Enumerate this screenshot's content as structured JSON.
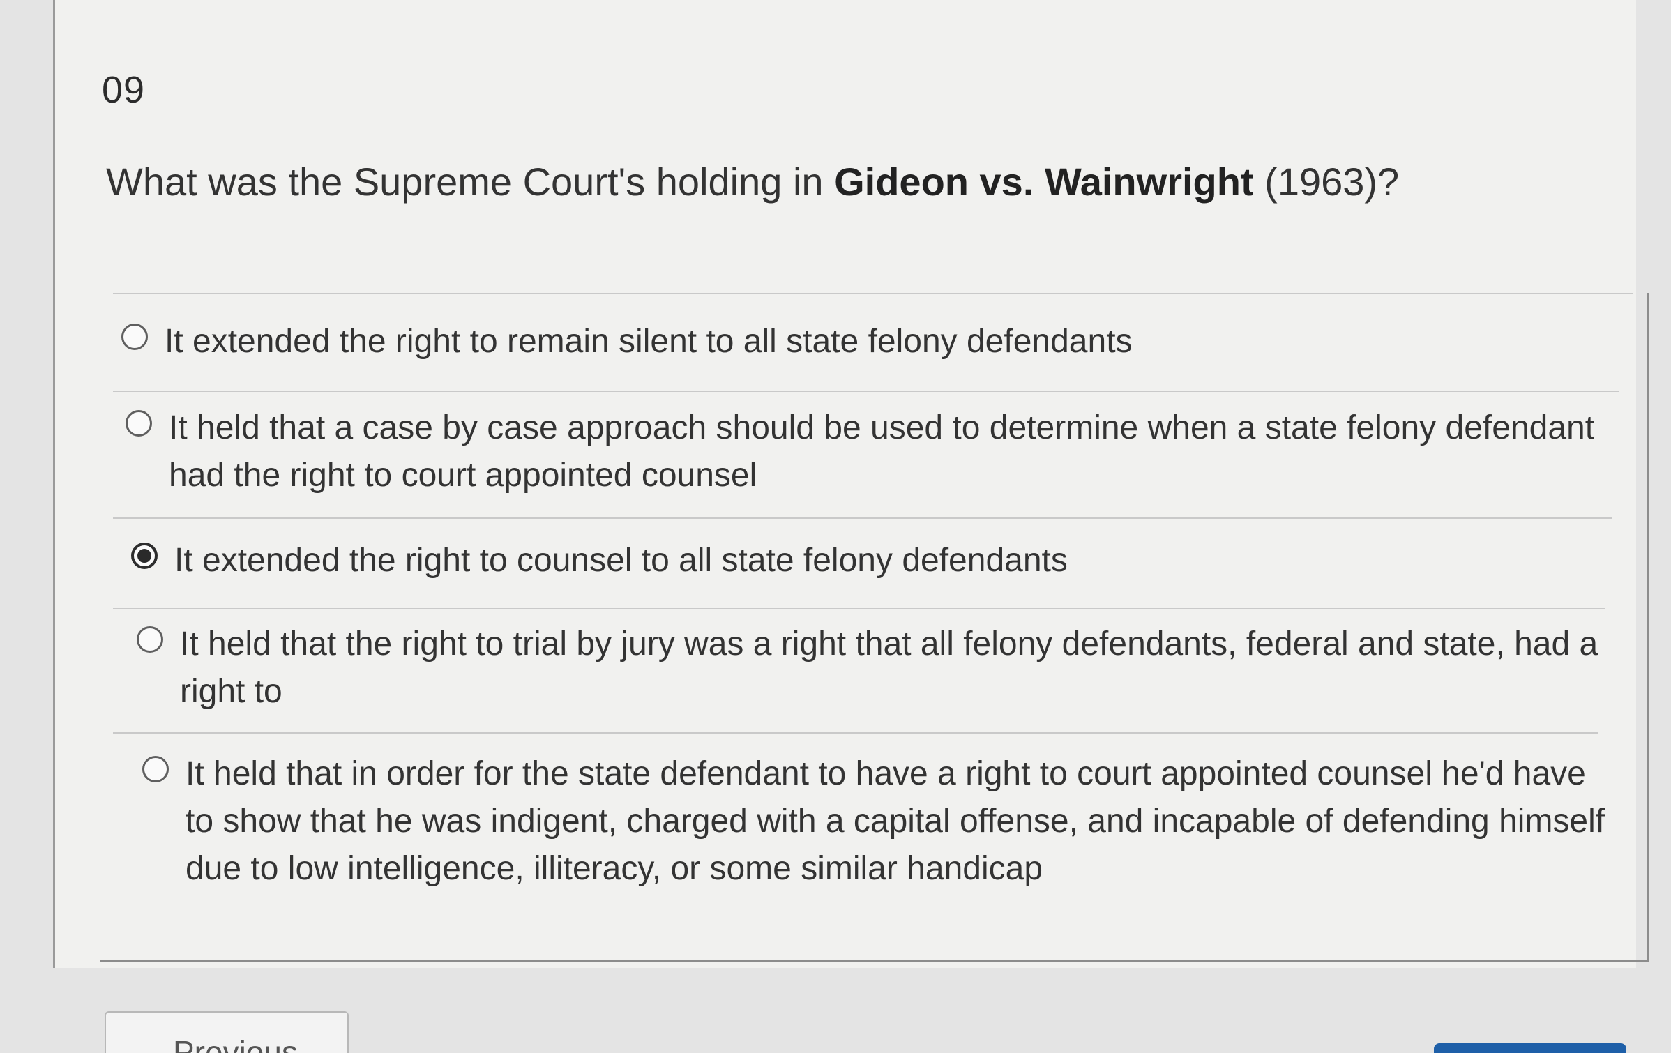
{
  "question": {
    "number": "09",
    "text_before": "What was the Supreme Court's holding in ",
    "text_case": "Gideon vs. Wainwright",
    "text_after": " (1963)?"
  },
  "options": [
    {
      "label": "It extended the right to remain silent to all state felony defendants",
      "selected": false
    },
    {
      "label": "It held that a case by case approach should be used to determine when a state felony defendant had the right to court appointed counsel",
      "selected": false
    },
    {
      "label": "It extended the right to counsel to all state felony defendants",
      "selected": true
    },
    {
      "label": "It held that the right to trial by jury was a right that all felony defendants, federal and state, had a right to",
      "selected": false
    },
    {
      "label": "It held that in order for the state defendant to have a right to court appointed counsel he'd have to show that he was indigent, charged with a capital offense, and incapable of defending himself due to low intelligence, illiteracy, or some similar handicap",
      "selected": false
    }
  ],
  "navigation": {
    "previous_label": "Previous",
    "previous_icon": "chevron-left-icon",
    "next_color": "#1e5fa8"
  }
}
